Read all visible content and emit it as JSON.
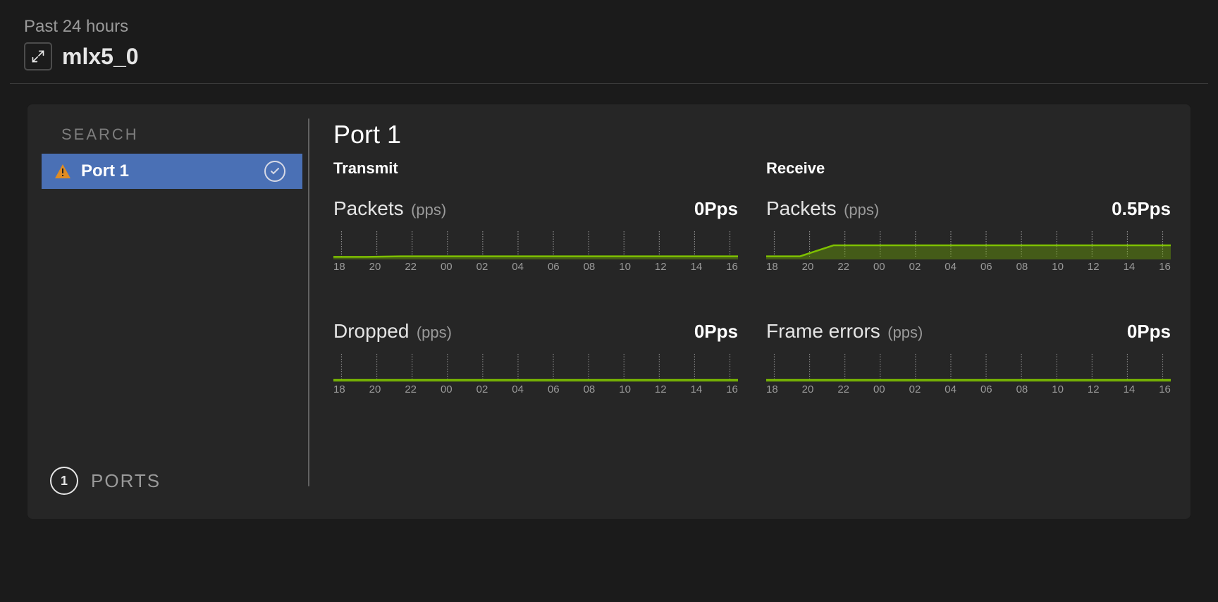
{
  "header": {
    "time_range": "Past 24 hours",
    "device_name": "mlx5_0",
    "expand_icon": "expand"
  },
  "sidebar": {
    "search_placeholder": "SEARCH",
    "items": [
      {
        "label": "Port 1",
        "status": "warning",
        "selected": true
      }
    ],
    "ports_count": "1",
    "ports_label": "PORTS"
  },
  "content": {
    "title": "Port 1",
    "columns": {
      "transmit": {
        "heading": "Transmit"
      },
      "receive": {
        "heading": "Receive"
      }
    }
  },
  "chart_data": {
    "x_ticks": [
      "18",
      "20",
      "22",
      "00",
      "02",
      "04",
      "06",
      "08",
      "10",
      "12",
      "14",
      "16"
    ],
    "transmit_packets": {
      "title": "Packets",
      "unit": "(pps)",
      "value_label": "0Pps",
      "ylim": [
        0,
        1
      ],
      "values": [
        0.02,
        0.02,
        0.04,
        0.04,
        0.04,
        0.04,
        0.04,
        0.04,
        0.04,
        0.04,
        0.04,
        0.04,
        0.04
      ]
    },
    "receive_packets": {
      "title": "Packets",
      "unit": "(pps)",
      "value_label": "0.5Pps",
      "ylim": [
        0,
        1
      ],
      "values": [
        0.04,
        0.04,
        0.5,
        0.5,
        0.5,
        0.5,
        0.5,
        0.5,
        0.5,
        0.5,
        0.5,
        0.5,
        0.5
      ]
    },
    "transmit_dropped": {
      "title": "Dropped",
      "unit": "(pps)",
      "value_label": "0Pps",
      "ylim": [
        0,
        1
      ],
      "values": [
        0,
        0,
        0,
        0,
        0,
        0,
        0,
        0,
        0,
        0,
        0,
        0,
        0
      ]
    },
    "receive_frame_errors": {
      "title": "Frame errors",
      "unit": "(pps)",
      "value_label": "0Pps",
      "ylim": [
        0,
        1
      ],
      "values": [
        0,
        0,
        0,
        0,
        0,
        0,
        0,
        0,
        0,
        0,
        0,
        0,
        0
      ]
    }
  }
}
